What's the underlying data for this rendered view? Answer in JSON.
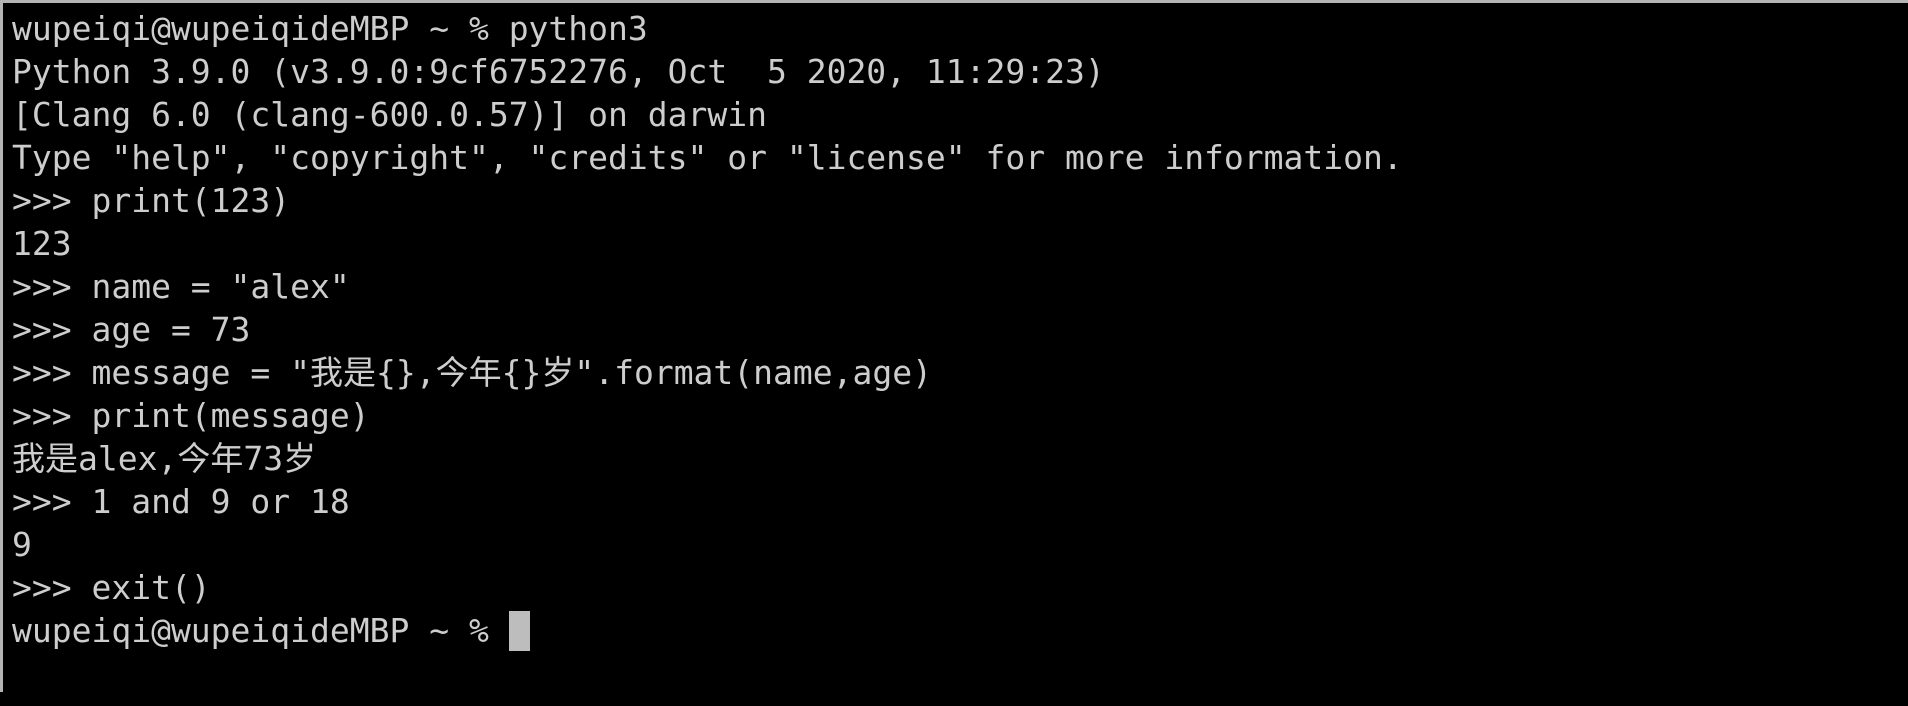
{
  "terminal": {
    "lines": [
      "wupeiqi@wupeiqideMBP ~ % python3",
      "Python 3.9.0 (v3.9.0:9cf6752276, Oct  5 2020, 11:29:23)",
      "[Clang 6.0 (clang-600.0.57)] on darwin",
      "Type \"help\", \"copyright\", \"credits\" or \"license\" for more information.",
      ">>> print(123)",
      "123",
      ">>> name = \"alex\"",
      ">>> age = 73",
      ">>> message = \"我是{},今年{}岁\".format(name,age)",
      ">>> print(message)",
      "我是alex,今年73岁",
      ">>> 1 and 9 or 18",
      "9",
      ">>> exit()"
    ],
    "prompt": "wupeiqi@wupeiqideMBP ~ % ",
    "colors": {
      "background": "#000000",
      "text": "#cdcdcd",
      "cursor": "#bdbdbd"
    }
  }
}
